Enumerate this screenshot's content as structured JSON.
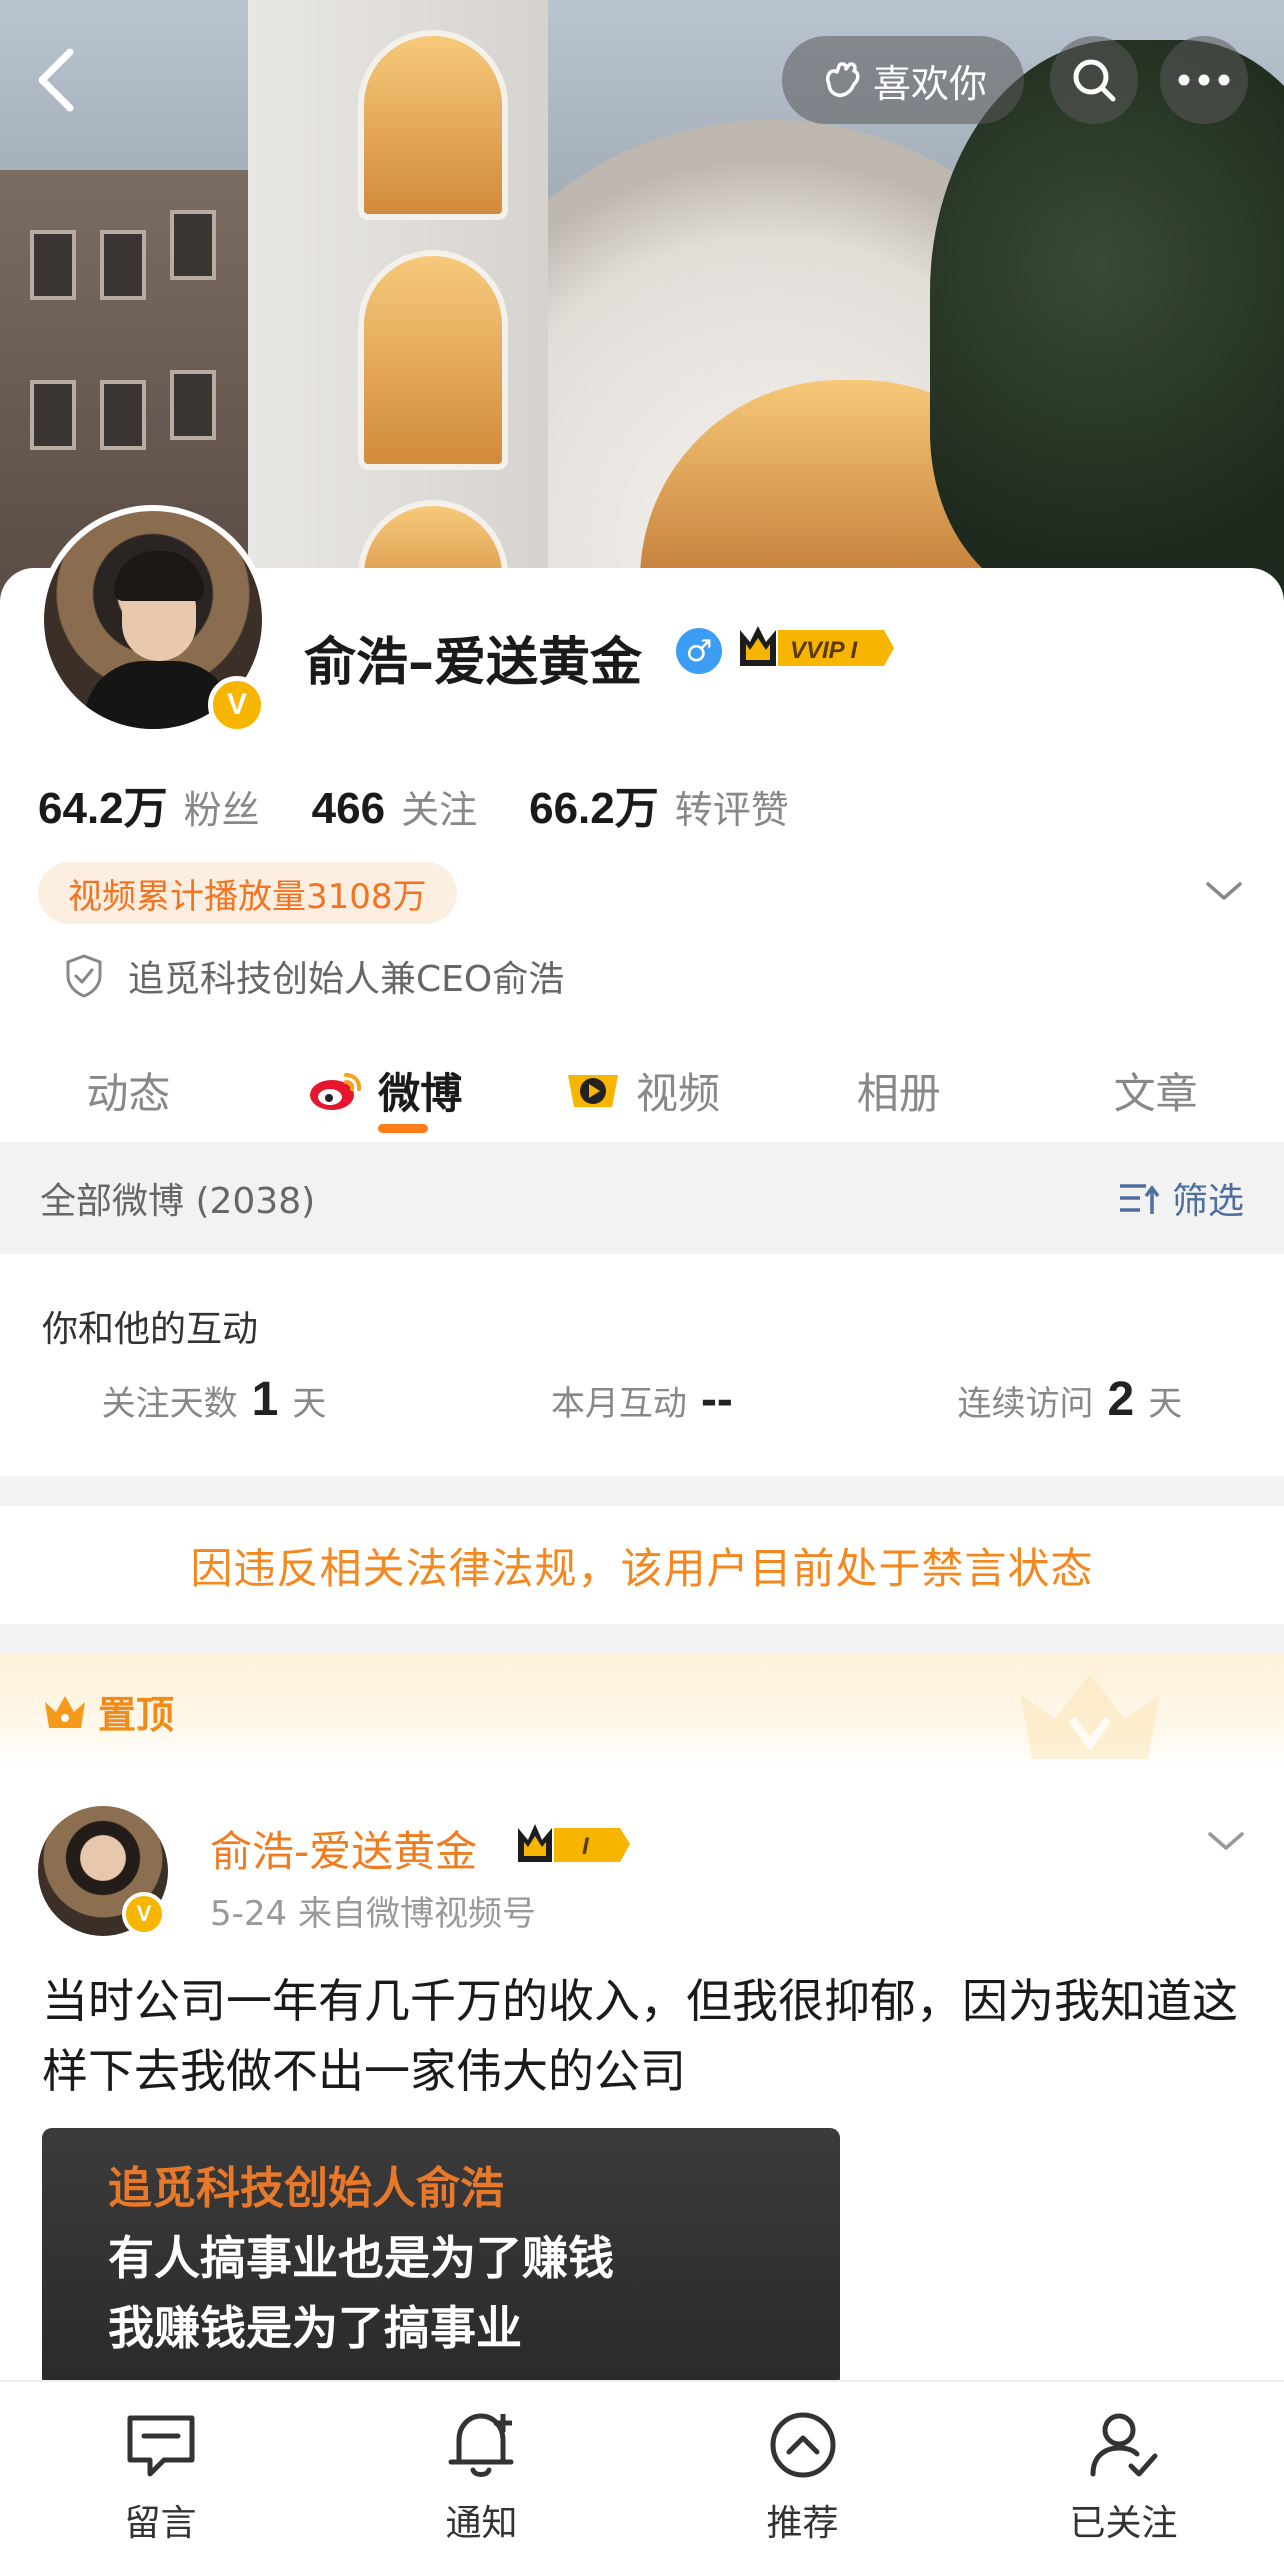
{
  "topbar": {
    "like_label": "喜欢你"
  },
  "profile": {
    "name": "俞浩–爱送黄金",
    "verified_mark": "V",
    "gender_mark": "♂",
    "vip_label": "VVIP I",
    "stats": [
      {
        "num": "64.2万",
        "label": "粉丝"
      },
      {
        "num": "466",
        "label": "关注"
      },
      {
        "num": "66.2万",
        "label": "转评赞"
      }
    ],
    "play_count": "视频累计播放量3108万",
    "certification": "追觅科技创始人兼CEO俞浩"
  },
  "tabs": [
    {
      "label": "动态"
    },
    {
      "label": "微博"
    },
    {
      "label": "视频"
    },
    {
      "label": "相册"
    },
    {
      "label": "文章"
    }
  ],
  "filter": {
    "all_label": "全部微博 (2038)",
    "filter_label": "筛选"
  },
  "interaction": {
    "title": "你和他的互动",
    "items": [
      {
        "label": "关注天数",
        "value": "1",
        "unit": "天"
      },
      {
        "label": "本月互动",
        "value": "--",
        "unit": ""
      },
      {
        "label": "连续访问",
        "value": "2",
        "unit": "天"
      }
    ]
  },
  "ban_notice": "因违反相关法律法规，该用户目前处于禁言状态",
  "pinned_label": "置顶",
  "post": {
    "author": "俞浩-爱送黄金",
    "vip_label": "I",
    "meta": "5-24  来自微博视频号",
    "text": "当时公司一年有几千万的收入，但我很抑郁，因为我知道这样下去我做不出一家伟大的公司",
    "thumb_lines": [
      "追觅科技创始人俞浩",
      "有人搞事业也是为了赚钱",
      "我赚钱是为了搞事业"
    ]
  },
  "bottom_nav": [
    {
      "label": "留言",
      "icon": "message-icon"
    },
    {
      "label": "通知",
      "icon": "bell-icon"
    },
    {
      "label": "推荐",
      "icon": "recommend-icon"
    },
    {
      "label": "已关注",
      "icon": "followed-user-icon"
    }
  ],
  "colors": {
    "accent": "#ff7d18",
    "verified": "#f7b500",
    "link": "#4f6ea0",
    "ban": "#f5871f"
  }
}
